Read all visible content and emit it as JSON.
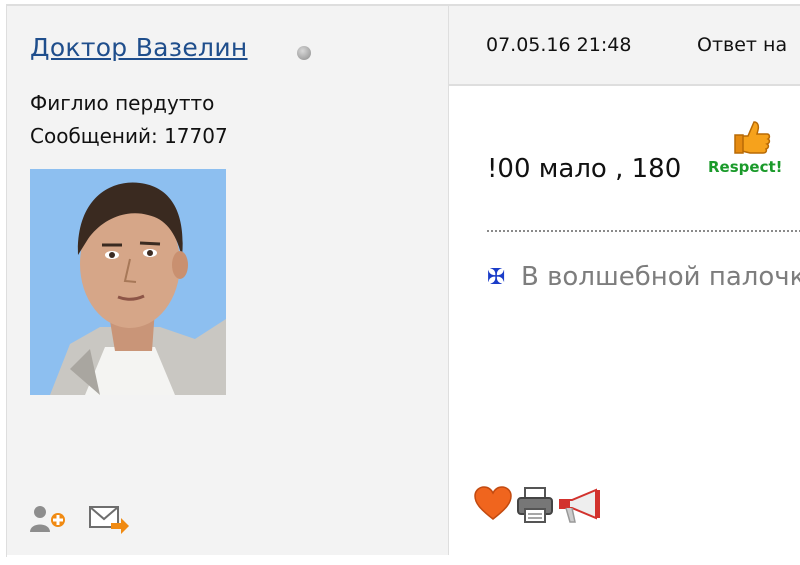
{
  "author": {
    "username": "Доктор  Вазелин",
    "title": "Фиглио пердутто",
    "post_count": "Сообщений: 17707",
    "status_icon": "offline-status-dot",
    "avatar": "user-avatar-photo"
  },
  "author_actions": [
    {
      "icon": "add-friend-icon"
    },
    {
      "icon": "send-message-icon"
    }
  ],
  "post": {
    "date": "07.05.16 21:48",
    "reply_label": "Ответ на",
    "message": "!00 мало , 180",
    "respect_label": "Respect!",
    "signature": "В волшебной палочке"
  },
  "post_actions": [
    {
      "icon": "like-heart-icon"
    },
    {
      "icon": "print-icon"
    },
    {
      "icon": "report-megaphone-icon"
    }
  ],
  "colors": {
    "username_link": "#1f4e8c",
    "respect_green": "#1a9a2a",
    "signature_gray": "#7d7d7d",
    "sidebar_bg": "#f3f3f3"
  }
}
